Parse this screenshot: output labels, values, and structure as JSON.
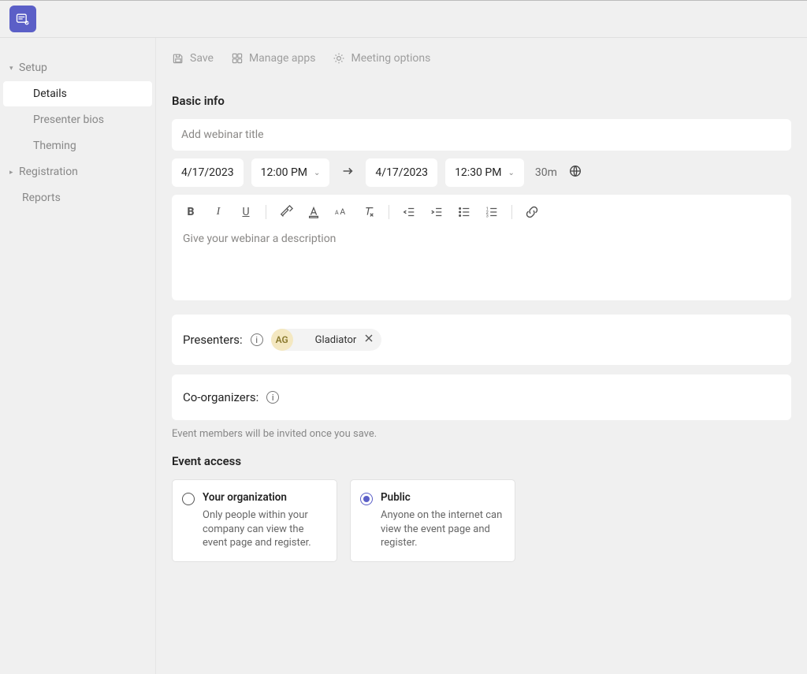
{
  "sidebar": {
    "groups": [
      {
        "label": "Setup",
        "expanded": true,
        "items": [
          {
            "label": "Details",
            "active": true
          },
          {
            "label": "Presenter bios"
          },
          {
            "label": "Theming"
          }
        ]
      },
      {
        "label": "Registration",
        "expanded": false,
        "items": []
      }
    ],
    "trailing": {
      "label": "Reports"
    }
  },
  "toolbar": {
    "save": "Save",
    "manage_apps": "Manage apps",
    "meeting_options": "Meeting options"
  },
  "basic_info": {
    "heading": "Basic info",
    "title_placeholder": "Add webinar title",
    "start_date": "4/17/2023",
    "start_time": "12:00 PM",
    "end_date": "4/17/2023",
    "end_time": "12:30 PM",
    "duration": "30m",
    "description_placeholder": "Give your webinar a description"
  },
  "editor_toolbar_icons": {
    "bold": "B",
    "italic": "I",
    "underline": "U"
  },
  "presenters": {
    "label": "Presenters:",
    "chip": {
      "initials": "AG",
      "name": "Gladiator"
    }
  },
  "coorganizers": {
    "label": "Co-organizers:"
  },
  "invite_note": "Event members will be invited once you save.",
  "event_access": {
    "heading": "Event access",
    "options": [
      {
        "id": "org",
        "title": "Your organization",
        "desc": "Only people within your company can view the event page and register.",
        "selected": false
      },
      {
        "id": "public",
        "title": "Public",
        "desc": "Anyone on the internet can view the event page and register.",
        "selected": true
      }
    ]
  }
}
